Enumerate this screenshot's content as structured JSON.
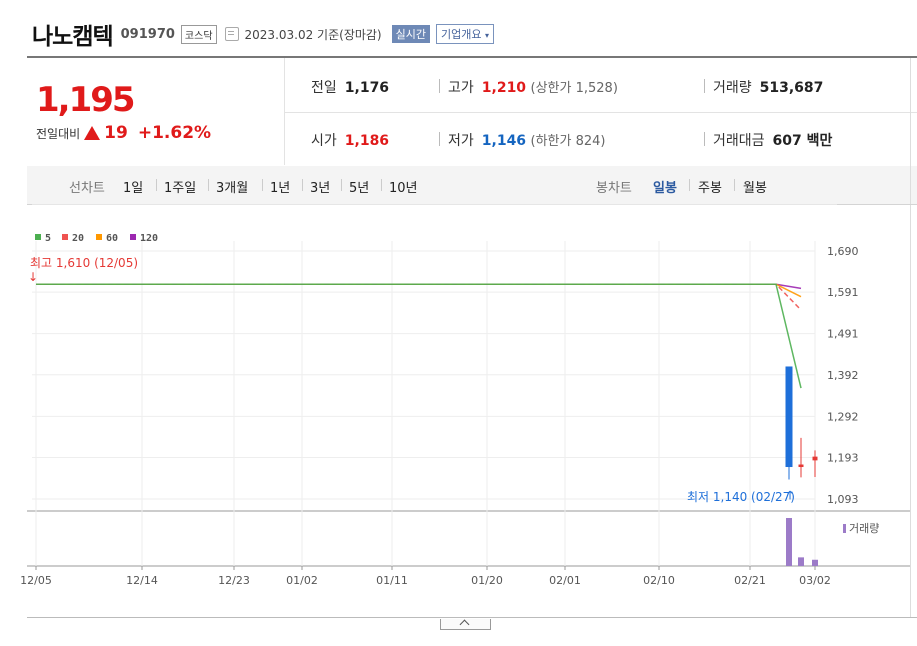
{
  "header": {
    "company": "나노캠텍",
    "code": "091970",
    "market": "코스닥",
    "date": "2023.03.02 기준(장마감)",
    "realtime": "실시간",
    "overview": "기업개요"
  },
  "quote": {
    "price": "1,195",
    "change_label": "전일대비",
    "change_value": "19",
    "change_pct": "+1.62%",
    "prev_close": {
      "label": "전일",
      "value": "1,176"
    },
    "open": {
      "label": "시가",
      "value": "1,186"
    },
    "high": {
      "label": "고가",
      "value": "1,210",
      "extra": "(상한가 1,528)"
    },
    "low": {
      "label": "저가",
      "value": "1,146",
      "extra": "(하한가 824)"
    },
    "volume": {
      "label": "거래량",
      "value": "513,687"
    },
    "amount": {
      "label": "거래대금",
      "value": "607 백만"
    }
  },
  "tabs": {
    "line_label": "선차트",
    "line_periods": [
      "1일",
      "1주일",
      "3개월",
      "1년",
      "3년",
      "5년",
      "10년"
    ],
    "candle_label": "봉차트",
    "candle_periods": [
      "일봉",
      "주봉",
      "월봉"
    ],
    "candle_selected": "일봉"
  },
  "chart_data": {
    "type": "line",
    "legend": [
      {
        "name": "5",
        "color": "#4caf50"
      },
      {
        "name": "20",
        "color": "#ef5350"
      },
      {
        "name": "60",
        "color": "#ff9800"
      },
      {
        "name": "120",
        "color": "#9c27b0"
      }
    ],
    "y_ticks": [
      "1,690",
      "1,591",
      "1,491",
      "1,392",
      "1,292",
      "1,193",
      "1,093"
    ],
    "ylim": [
      1093,
      1690
    ],
    "x_ticks": [
      "12/05",
      "12/14",
      "12/23",
      "01/02",
      "01/11",
      "01/20",
      "02/01",
      "02/10",
      "02/21",
      "03/02"
    ],
    "high_annotation": "최고 1,610 (12/05)",
    "low_annotation": "최저 1,140 (02/27)",
    "high_value": 1610,
    "moving_averages": [
      {
        "name": "5",
        "x": [
          "12/05",
          "02/24",
          "02/28"
        ],
        "values": [
          1610,
          1610,
          1360
        ]
      },
      {
        "name": "20",
        "x": [
          "12/05",
          "02/24",
          "02/28"
        ],
        "values": [
          1610,
          1610,
          1548
        ]
      },
      {
        "name": "60",
        "x": [
          "12/05",
          "02/24",
          "02/28"
        ],
        "values": [
          1610,
          1610,
          1580
        ]
      },
      {
        "name": "120",
        "x": [
          "12/05",
          "02/24",
          "02/28"
        ],
        "values": [
          1610,
          1610,
          1600
        ]
      }
    ],
    "candles": [
      {
        "x": "02/27",
        "open": 1412,
        "close": 1170,
        "high": 1412,
        "low": 1140,
        "color": "#1e6fd9"
      },
      {
        "x": "02/28",
        "open": 1176,
        "close": 1170,
        "high": 1240,
        "low": 1145,
        "color": "#e53935"
      },
      {
        "x": "03/02",
        "open": 1186,
        "close": 1195,
        "high": 1210,
        "low": 1146,
        "color": "#e53935"
      }
    ],
    "volume_label": "거래량",
    "volume": [
      {
        "x": "02/27",
        "value": 1.0
      },
      {
        "x": "02/28",
        "value": 0.18
      },
      {
        "x": "03/02",
        "value": 0.13
      }
    ]
  }
}
